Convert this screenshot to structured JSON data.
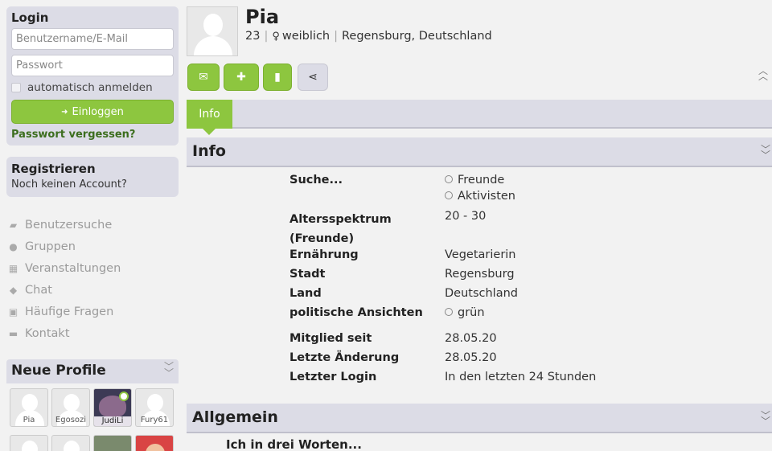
{
  "login": {
    "title": "Login",
    "username_placeholder": "Benutzername/E-Mail",
    "password_placeholder": "Passwort",
    "remember_label": "automatisch anmelden",
    "login_button": "Einloggen",
    "forgot_link": "Passwort vergessen?"
  },
  "register": {
    "title": "Registrieren",
    "subtitle": "Noch keinen Account?"
  },
  "nav": [
    {
      "label": "Benutzersuche",
      "icon": "folder-open-icon"
    },
    {
      "label": "Gruppen",
      "icon": "globe-icon"
    },
    {
      "label": "Veranstaltungen",
      "icon": "calendar-icon"
    },
    {
      "label": "Chat",
      "icon": "chat-icon"
    },
    {
      "label": "Häufige Fragen",
      "icon": "first-aid-icon"
    },
    {
      "label": "Kontakt",
      "icon": "truck-icon"
    }
  ],
  "new_profiles": {
    "title": "Neue Profile",
    "items": [
      {
        "name": "Pia"
      },
      {
        "name": "Egosozi"
      },
      {
        "name": "JudiLi",
        "online": true
      },
      {
        "name": "Fury61"
      }
    ]
  },
  "profile": {
    "name": "Pia",
    "age": "23",
    "gender": "weiblich",
    "location": "Regensburg, Deutschland",
    "actions": [
      "envelope-icon",
      "add-friend-icon",
      "bookmark-icon",
      "share-icon"
    ]
  },
  "tabs": [
    {
      "label": "Info",
      "active": true
    }
  ],
  "info_section": {
    "title": "Info",
    "rows": [
      {
        "key": "Suche...",
        "values": [
          "Freunde",
          "Aktivisten"
        ],
        "radio": true
      },
      {
        "key": "Altersspektrum (Freunde)",
        "value": "20 - 30"
      },
      {
        "key": "Ernährung",
        "value": "Vegetarierin"
      },
      {
        "key": "Stadt",
        "value": "Regensburg"
      },
      {
        "key": "Land",
        "value": "Deutschland"
      },
      {
        "key": "politische Ansichten",
        "values": [
          "grün"
        ],
        "radio": true
      },
      {
        "key": "Mitglied seit",
        "value": "28.05.20"
      },
      {
        "key": "Letzte Änderung",
        "value": "28.05.20"
      },
      {
        "key": "Letzter Login",
        "value": "In den letzten 24 Stunden"
      }
    ]
  },
  "general_section": {
    "title": "Allgemein",
    "first_question": "Ich in drei Worten..."
  },
  "colors": {
    "accent": "#8dc63f",
    "panel": "#dcdce6",
    "link_dark_green": "#3c6e1e"
  }
}
